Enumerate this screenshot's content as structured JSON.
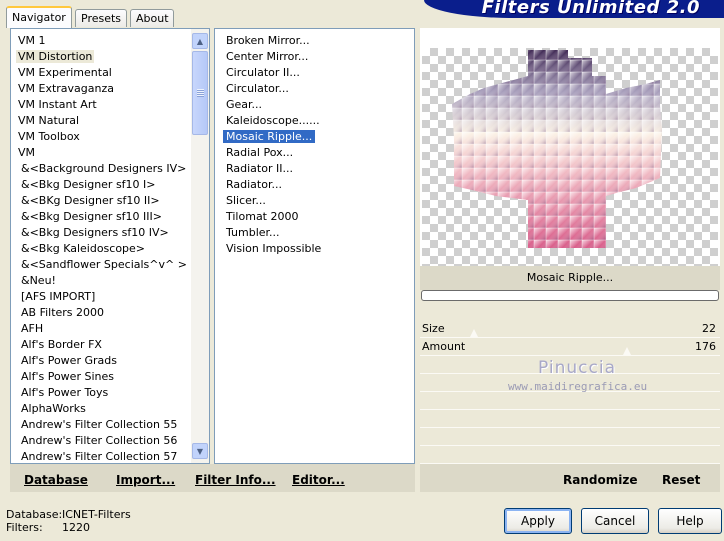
{
  "tabs": [
    {
      "label": "Navigator",
      "active": true
    },
    {
      "label": "Presets",
      "active": false
    },
    {
      "label": "About",
      "active": false
    }
  ],
  "banner": {
    "title": "Filters Unlimited 2.0"
  },
  "categories": {
    "selected": "VM Distortion",
    "items": [
      "VM 1",
      "VM Distortion",
      "VM Experimental",
      "VM Extravaganza",
      "VM Instant Art",
      "VM Natural",
      "VM Toolbox",
      "VM",
      "&<Background Designers IV>",
      "&<Bkg Designer sf10 I>",
      "&<BKg Designer sf10 II>",
      "&<Bkg Designer sf10 III>",
      "&<Bkg Designers sf10 IV>",
      "&<Bkg Kaleidoscope>",
      "&<Sandflower Specials^v^ >",
      "&Neu!",
      "[AFS IMPORT]",
      "AB Filters 2000",
      "AFH",
      "Alf's Border FX",
      "Alf's Power Grads",
      "Alf's Power Sines",
      "Alf's Power Toys",
      "AlphaWorks",
      "Andrew's Filter Collection 55",
      "Andrew's Filter Collection 56",
      "Andrew's Filter Collection 57"
    ]
  },
  "filters": {
    "selected": "Mosaic Ripple...",
    "items": [
      "Broken Mirror...",
      "Center Mirror...",
      "Circulator II...",
      "Circulator...",
      "Gear...",
      "Kaleidoscope......",
      "Mosaic Ripple...",
      "Radial Pox...",
      "Radiator II...",
      "Radiator...",
      "Slicer...",
      "Tilomat 2000",
      "Tumbler...",
      "Vision Impossible"
    ]
  },
  "preview": {
    "filter_name": "Mosaic Ripple..."
  },
  "parameters": [
    {
      "label": "Size",
      "value": "22",
      "max": 255
    },
    {
      "label": "Amount",
      "value": "176",
      "max": 255
    }
  ],
  "watermark": {
    "name": "Pinuccia",
    "url": "www.maidiregrafica.eu"
  },
  "toolbar": {
    "database": "Database",
    "import": "Import...",
    "filter_info": "Filter Info...",
    "editor": "Editor...",
    "randomize": "Randomize",
    "reset": "Reset"
  },
  "status": {
    "database_label": "Database:",
    "database_value": "ICNET-Filters",
    "filters_label": "Filters:",
    "filters_value": "1220"
  },
  "buttons": {
    "apply": "Apply",
    "cancel": "Cancel",
    "help": "Help"
  },
  "colors": {
    "accent": "#316ac5",
    "banner": "#0a1e8c",
    "panel": "#ece9d8"
  }
}
